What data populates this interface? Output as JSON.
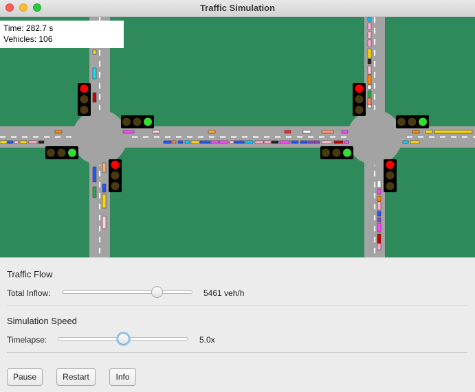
{
  "window": {
    "title": "Traffic Simulation"
  },
  "status": {
    "time_text": "Time: 282.7 s",
    "vehicles_text": "Vehicles: 106"
  },
  "colors": {
    "grass": "#2f8a5b",
    "road": "#a3a3a3",
    "lane_mark": "#ffffff",
    "light_red": "#ff0000",
    "light_green": "#33dd33",
    "light_off": "#4a3a12"
  },
  "traffic_flow": {
    "heading": "Traffic Flow",
    "label": "Total Inflow:",
    "value_text": "5461 veh/h",
    "slider_fraction": 0.75
  },
  "simulation_speed": {
    "heading": "Simulation Speed",
    "label": "Timelapse:",
    "value_text": "5.0x",
    "slider_fraction": 0.5
  },
  "buttons": {
    "pause": "Pause",
    "restart": "Restart",
    "info": "Info"
  }
}
